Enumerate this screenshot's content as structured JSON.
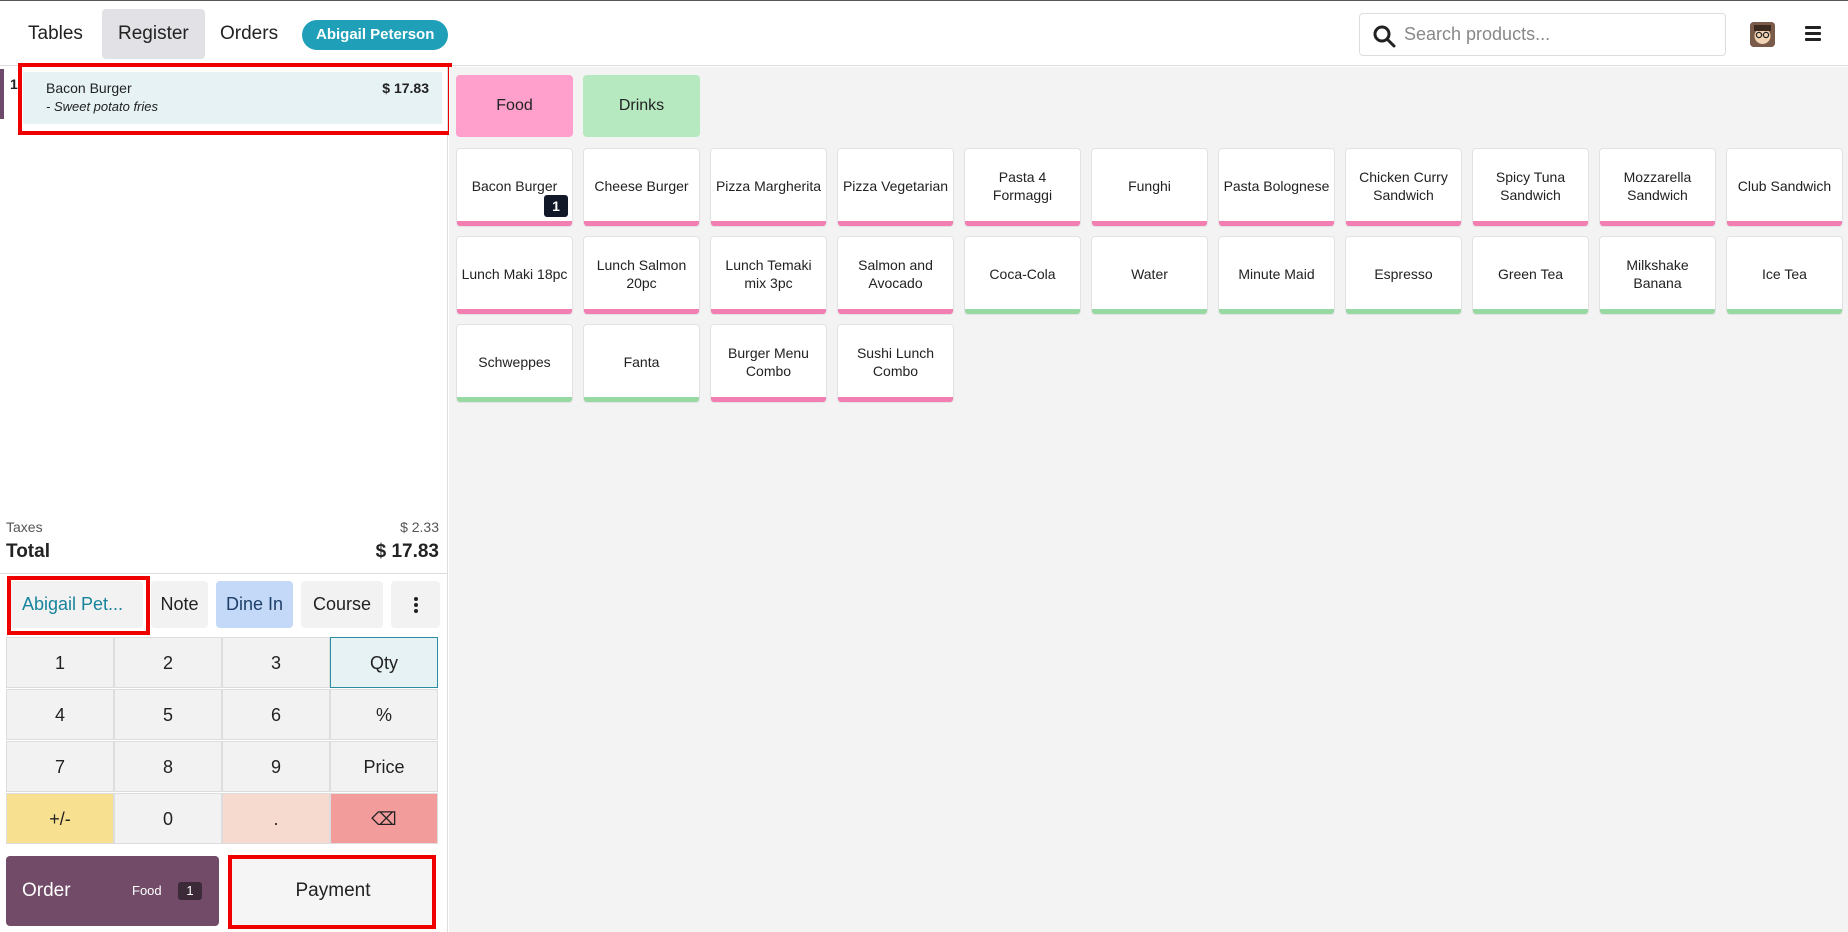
{
  "topbar": {
    "tabs": [
      {
        "label": "Tables",
        "active": false
      },
      {
        "label": "Register",
        "active": true
      },
      {
        "label": "Orders",
        "active": false
      }
    ],
    "user": "Abigail Peterson",
    "search_placeholder": "Search products...",
    "icons": [
      "search-icon",
      "avatar",
      "hamburger-menu-icon"
    ]
  },
  "order": {
    "lines": [
      {
        "qty": "1",
        "name": "Bacon Burger",
        "price": "$ 17.83",
        "attribute": "- Sweet potato fries"
      }
    ],
    "taxes_label": "Taxes",
    "taxes_value": "$ 2.33",
    "total_label": "Total",
    "total_value": "$ 17.83"
  },
  "actions": {
    "customer": "Abigail Pet...",
    "note": "Note",
    "dine_in": "Dine In",
    "course": "Course",
    "more_icon": "kebab-menu-icon"
  },
  "numpad": {
    "keys": [
      "1",
      "2",
      "3",
      "Qty",
      "4",
      "5",
      "6",
      "%",
      "7",
      "8",
      "9",
      "Price",
      "+/-",
      "0",
      ".",
      "⌫"
    ]
  },
  "footer": {
    "order_label": "Order",
    "order_category": "Food",
    "order_count": "1",
    "payment_label": "Payment"
  },
  "categories": [
    {
      "label": "Food",
      "color": "#ff9fcb"
    },
    {
      "label": "Drinks",
      "color": "#b6e9c0"
    }
  ],
  "colors": {
    "food": "#f27eb2",
    "drink": "#98d9a3",
    "accent": "#714b67",
    "teal": "#1fa0b8"
  },
  "products": [
    {
      "name": "Bacon Burger",
      "type": "food",
      "badge": "1"
    },
    {
      "name": "Cheese Burger",
      "type": "food"
    },
    {
      "name": "Pizza Margherita",
      "type": "food"
    },
    {
      "name": "Pizza Vegetarian",
      "type": "food"
    },
    {
      "name": "Pasta 4 Formaggi",
      "type": "food"
    },
    {
      "name": "Funghi",
      "type": "food"
    },
    {
      "name": "Pasta Bolognese",
      "type": "food"
    },
    {
      "name": "Chicken Curry Sandwich",
      "type": "food"
    },
    {
      "name": "Spicy Tuna Sandwich",
      "type": "food"
    },
    {
      "name": "Mozzarella Sandwich",
      "type": "food"
    },
    {
      "name": "Club Sandwich",
      "type": "food"
    },
    {
      "name": "Lunch Maki 18pc",
      "type": "food"
    },
    {
      "name": "Lunch Salmon 20pc",
      "type": "food"
    },
    {
      "name": "Lunch Temaki mix 3pc",
      "type": "food"
    },
    {
      "name": "Salmon and Avocado",
      "type": "food"
    },
    {
      "name": "Coca-Cola",
      "type": "drink"
    },
    {
      "name": "Water",
      "type": "drink"
    },
    {
      "name": "Minute Maid",
      "type": "drink"
    },
    {
      "name": "Espresso",
      "type": "drink"
    },
    {
      "name": "Green Tea",
      "type": "drink"
    },
    {
      "name": "Milkshake Banana",
      "type": "drink"
    },
    {
      "name": "Ice Tea",
      "type": "drink"
    },
    {
      "name": "Schweppes",
      "type": "drink"
    },
    {
      "name": "Fanta",
      "type": "drink"
    },
    {
      "name": "Burger Menu Combo",
      "type": "food"
    },
    {
      "name": "Sushi Lunch Combo",
      "type": "food"
    }
  ]
}
